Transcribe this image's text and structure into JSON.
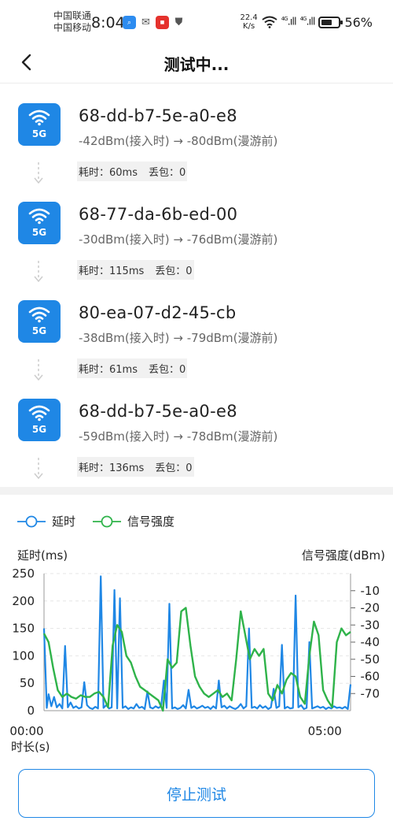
{
  "status_bar": {
    "carrier_1": "中国联通",
    "carrier_2": "中国移动",
    "time": "8:04",
    "net_speed_value": "22.4",
    "net_speed_unit": "K/s",
    "network_1": "4G",
    "network_2": "4G",
    "battery": "56%",
    "battery_level": 0.56
  },
  "header": {
    "back_icon": "chevron-left-icon",
    "title": "测试中..."
  },
  "access_points": [
    {
      "band": "5G",
      "mac": "68-dd-b7-5e-a0-e8",
      "signal": "-42dBm(接入时) → -80dBm(漫游前)",
      "time_cost": "耗时：60ms",
      "packet_loss": "丢包：0"
    },
    {
      "band": "5G",
      "mac": "68-77-da-6b-ed-00",
      "signal": "-30dBm(接入时) → -76dBm(漫游前)",
      "time_cost": "耗时：115ms",
      "packet_loss": "丢包：0"
    },
    {
      "band": "5G",
      "mac": "80-ea-07-d2-45-cb",
      "signal": "-38dBm(接入时) → -79dBm(漫游前)",
      "time_cost": "耗时：61ms",
      "packet_loss": "丢包：0"
    },
    {
      "band": "5G",
      "mac": "68-dd-b7-5e-a0-e8",
      "signal": "-59dBm(接入时) → -78dBm(漫游前)",
      "time_cost": "耗时：136ms",
      "packet_loss": "丢包：0"
    }
  ],
  "legend": {
    "latency": "延时",
    "signal": "信号强度"
  },
  "chart_data": {
    "type": "line",
    "left_axis_label": "延时(ms)",
    "right_axis_label": "信号强度(dBm)",
    "x_label": "时长(s)",
    "x_ticks": [
      "00:00",
      "05:00"
    ],
    "y_left_ticks": [
      "0",
      "50",
      "100",
      "150",
      "200",
      "250"
    ],
    "y_left_range": [
      0,
      250
    ],
    "y_right_ticks": [
      "-10",
      "-20",
      "-30",
      "-40",
      "-50",
      "-60",
      "-70"
    ],
    "y_right_range": [
      -80,
      0
    ],
    "x_range_seconds": [
      0,
      335
    ],
    "colors": {
      "latency": "#1f87e5",
      "signal": "#2fb34a"
    },
    "series": [
      {
        "name": "延时",
        "axis": "left",
        "x": [
          0,
          3,
          5,
          8,
          11,
          14,
          17,
          20,
          23,
          26,
          29,
          32,
          35,
          38,
          41,
          44,
          47,
          50,
          53,
          56,
          59,
          62,
          65,
          68,
          71,
          74,
          77,
          80,
          83,
          86,
          89,
          92,
          95,
          98,
          101,
          104,
          107,
          110,
          113,
          116,
          119,
          122,
          125,
          128,
          131,
          134,
          137,
          140,
          143,
          146,
          149,
          152,
          155,
          158,
          161,
          164,
          167,
          170,
          173,
          176,
          179,
          182,
          185,
          188,
          191,
          194,
          197,
          200,
          203,
          206,
          209,
          212,
          215,
          218,
          221,
          224,
          227,
          230,
          233,
          236,
          239,
          242,
          245,
          248,
          251,
          254,
          257,
          260,
          263,
          266,
          269,
          272,
          275,
          278,
          281,
          284,
          287,
          290,
          293,
          296,
          299,
          302,
          305,
          308,
          311,
          314,
          317,
          320,
          323,
          326,
          329,
          332,
          335
        ],
        "values": [
          150,
          5,
          30,
          8,
          25,
          6,
          12,
          4,
          118,
          6,
          15,
          5,
          8,
          4,
          6,
          52,
          10,
          5,
          3,
          7,
          4,
          245,
          5,
          10,
          4,
          6,
          220,
          4,
          205,
          5,
          8,
          3,
          6,
          4,
          12,
          5,
          7,
          3,
          35,
          6,
          4,
          8,
          5,
          8,
          55,
          5,
          195,
          4,
          6,
          3,
          5,
          10,
          4,
          38,
          5,
          8,
          4,
          6,
          9,
          5,
          7,
          3,
          8,
          4,
          55,
          6,
          9,
          4,
          8,
          5,
          3,
          6,
          12,
          4,
          8,
          150,
          5,
          7,
          4,
          10,
          5,
          8,
          3,
          6,
          40,
          5,
          8,
          120,
          4,
          7,
          4,
          5,
          210,
          6,
          10,
          3,
          5,
          125,
          4,
          6,
          8,
          5,
          7,
          3,
          6,
          4,
          8,
          5,
          6,
          4,
          7,
          3,
          48
        ],
        "note": ""
      },
      {
        "name": "信号强度",
        "axis": "right",
        "x": [
          0,
          5,
          10,
          15,
          20,
          25,
          30,
          35,
          40,
          45,
          50,
          55,
          60,
          65,
          70,
          75,
          80,
          85,
          90,
          95,
          100,
          105,
          110,
          115,
          120,
          125,
          130,
          135,
          140,
          145,
          150,
          155,
          160,
          165,
          170,
          175,
          180,
          185,
          190,
          195,
          200,
          205,
          210,
          215,
          220,
          225,
          230,
          235,
          240,
          245,
          250,
          255,
          260,
          265,
          270,
          275,
          280,
          285,
          290,
          295,
          300,
          305,
          310,
          315,
          320,
          325,
          330,
          335
        ],
        "values": [
          -35,
          -40,
          -55,
          -68,
          -72,
          -70,
          -72,
          -73,
          -71,
          -72,
          -72,
          -70,
          -69,
          -72,
          -78,
          -42,
          -30,
          -34,
          -48,
          -52,
          -60,
          -66,
          -68,
          -70,
          -72,
          -74,
          -80,
          -50,
          -55,
          -52,
          -22,
          -20,
          -42,
          -60,
          -66,
          -70,
          -72,
          -70,
          -68,
          -72,
          -70,
          -74,
          -50,
          -22,
          -36,
          -50,
          -44,
          -48,
          -44,
          -70,
          -74,
          -65,
          -70,
          -62,
          -58,
          -60,
          -72,
          -76,
          -48,
          -28,
          -36,
          -68,
          -74,
          -78,
          -40,
          -32,
          -36,
          -34
        ]
      }
    ]
  },
  "actions": {
    "stop_label": "停止测试"
  }
}
